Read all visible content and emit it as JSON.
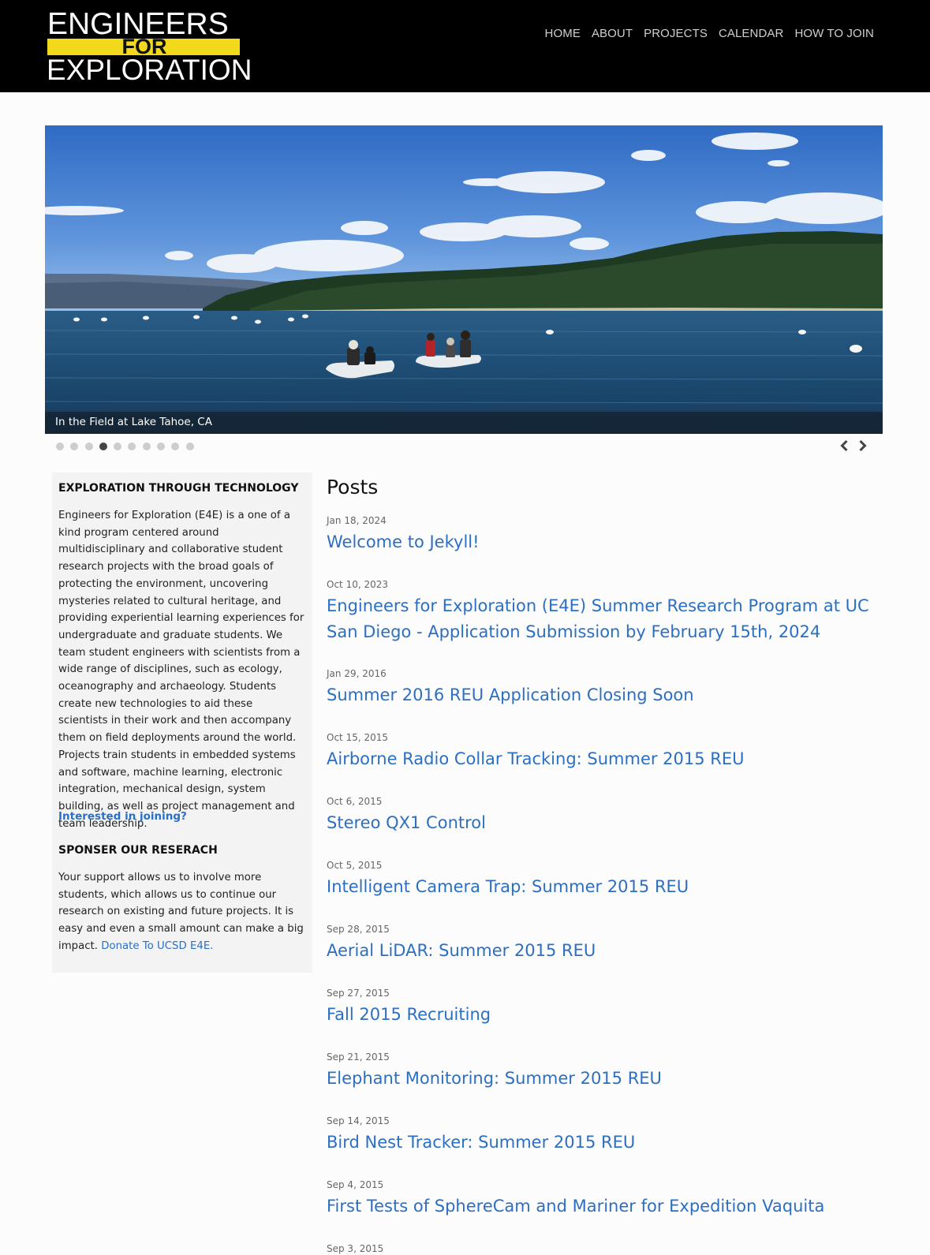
{
  "header": {
    "logo": {
      "line1": "ENGINEERS",
      "line2": "FOR",
      "line3": "EXPLORATION"
    },
    "nav": [
      "HOME",
      "ABOUT",
      "PROJECTS",
      "CALENDAR",
      "HOW TO JOIN"
    ]
  },
  "carousel": {
    "caption": "In the Field at Lake Tahoe, CA",
    "slide_count": 10,
    "active_index": 3
  },
  "sidebar": {
    "heading1": "EXPLORATION THROUGH TECHNOLOGY",
    "intro": "Engineers for Exploration (E4E) is a one of a kind program centered around multidisciplinary and collaborative student research projects with the broad goals of protecting the environment, uncovering mysteries related to cultural heritage, and providing experiential learning experiences for undergraduate and graduate students. We team student engineers with scientists from a wide range of disciplines, such as ecology, oceanography and archaeology. Students create new technologies to aid these scientists in their work and then accompany them on field deployments around the world. Projects train students in embedded systems and software, machine learning, electronic integration, mechanical design, system building, as well as project management and team leadership.",
    "join_link": "Interested in joining?",
    "heading2": "SPONSER OUR RESERACH",
    "sponsor_text": "Your support allows us to involve more students, which allows us to continue our research on existing and future projects. It is easy and even a small amount can make a big impact.",
    "donate_link": "Donate To UCSD E4E."
  },
  "posts": {
    "title": "Posts",
    "items": [
      {
        "date": "Jan 18, 2024",
        "title": "Welcome to Jekyll!"
      },
      {
        "date": "Oct 10, 2023",
        "title": "Engineers for Exploration (E4E) Summer Research Program at UC San Diego - Application Submission by February 15th, 2024"
      },
      {
        "date": "Jan 29, 2016",
        "title": "Summer 2016 REU Application Closing Soon"
      },
      {
        "date": "Oct 15, 2015",
        "title": "Airborne Radio Collar Tracking: Summer 2015 REU"
      },
      {
        "date": "Oct 6, 2015",
        "title": "Stereo QX1 Control"
      },
      {
        "date": "Oct 5, 2015",
        "title": "Intelligent Camera Trap: Summer 2015 REU"
      },
      {
        "date": "Sep 28, 2015",
        "title": "Aerial LiDAR: Summer 2015 REU"
      },
      {
        "date": "Sep 27, 2015",
        "title": "Fall 2015 Recruiting"
      },
      {
        "date": "Sep 21, 2015",
        "title": "Elephant Monitoring: Summer 2015 REU"
      },
      {
        "date": "Sep 14, 2015",
        "title": "Bird Nest Tracker: Summer 2015 REU"
      },
      {
        "date": "Sep 4, 2015",
        "title": "First Tests of SphereCam and Mariner for Expedition Vaquita"
      },
      {
        "date": "Sep 3, 2015",
        "title": ""
      }
    ]
  },
  "colors": {
    "header_bg": "#000000",
    "logo_accent": "#f2d91c",
    "link": "#2c6fc2"
  }
}
